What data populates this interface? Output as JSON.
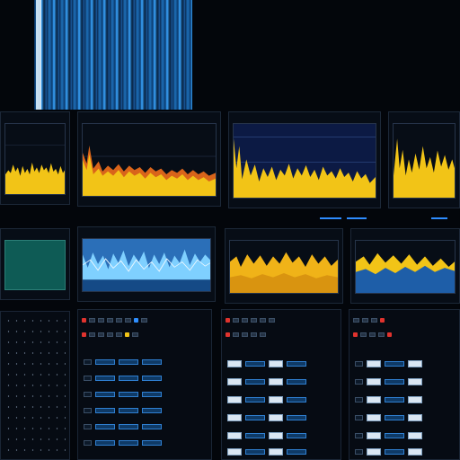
{
  "colors": {
    "background": "#03060b",
    "panel": "#070d16",
    "accent_blue": "#2e8cff",
    "trace_yellow": "#f2c417",
    "trace_orange": "#d9641a",
    "trace_cyan": "#7fd0ff",
    "teal": "#0e5b55"
  },
  "icons": [
    "led-indicator",
    "knob",
    "fader-button"
  ]
}
